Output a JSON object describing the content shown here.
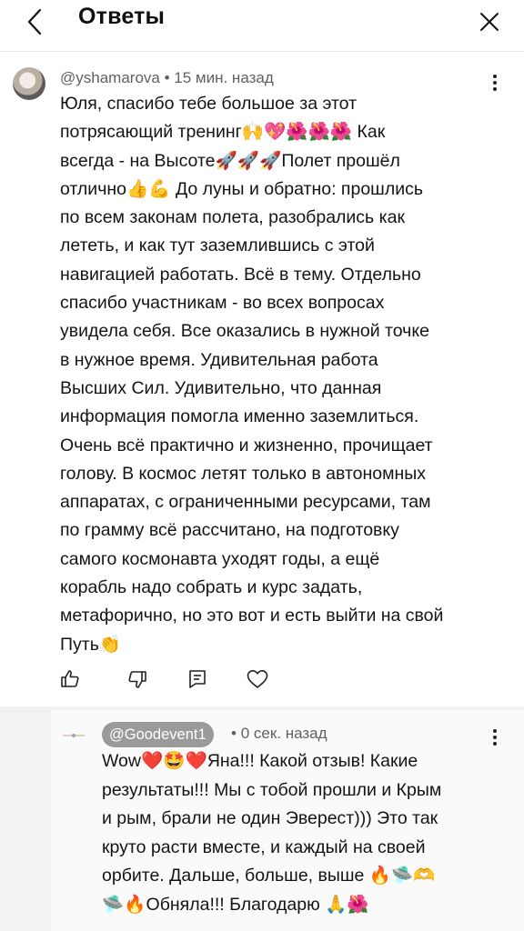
{
  "header": {
    "title": "Ответы"
  },
  "comment": {
    "author": "@yshamarova",
    "time": "15 мин. назад",
    "lines": [
      "Юля, спасибо тебе большое за этот",
      "потрясающий тренинг🙌💖🌺🌺🌺 Как",
      "всегда - на Высоте🚀🚀🚀Полет прошёл",
      "отлично👍💪 До луны и обратно: прошлись",
      "по всем законам полета, разобрались как",
      "лететь, и как тут заземлившись с этой",
      "навигацией работать. Всё в тему. Отдельно",
      "спасибо участникам - во всех вопросах",
      "увидела себя. Все оказались в нужной точке",
      "в нужное время. Удивительная работа",
      "Высших Сил. Удивительно, что данная",
      "информация помогла именно заземлиться.",
      "Очень всё практично и жизненно, прочищает",
      "голову. В космос летят только в автономных",
      "аппаратах, с ограниченными ресурсами, там",
      "по грамму всё рассчитано, на подготовку",
      "самого космонавта уходят годы, а ещё",
      "корабль надо собрать и курс задать,",
      "метафорично, но это вот и есть выйти на свой",
      "Путь👏"
    ]
  },
  "reply": {
    "author": "@Goodevent1",
    "time": "0 сек. назад",
    "lines": [
      "Wow❤️🤩❤️Яна!!! Какой отзыв! Какие",
      "результаты!!! Мы с тобой прошли и Крым",
      "и рым, брали не один Эверест))) Это так",
      "круто расти вместе, и каждый на своей",
      "орбите. Дальше, больше, выше 🔥🛸🫶",
      "🛸🔥Обняла!!! Благодарю 🙏🌺"
    ]
  },
  "icons": {
    "back": "chevron-left-icon",
    "close": "close-icon",
    "menu": "more-vertical-icon",
    "like": "thumbs-up-icon",
    "dislike": "thumbs-down-icon",
    "reply": "reply-icon",
    "heart": "heart-icon"
  }
}
